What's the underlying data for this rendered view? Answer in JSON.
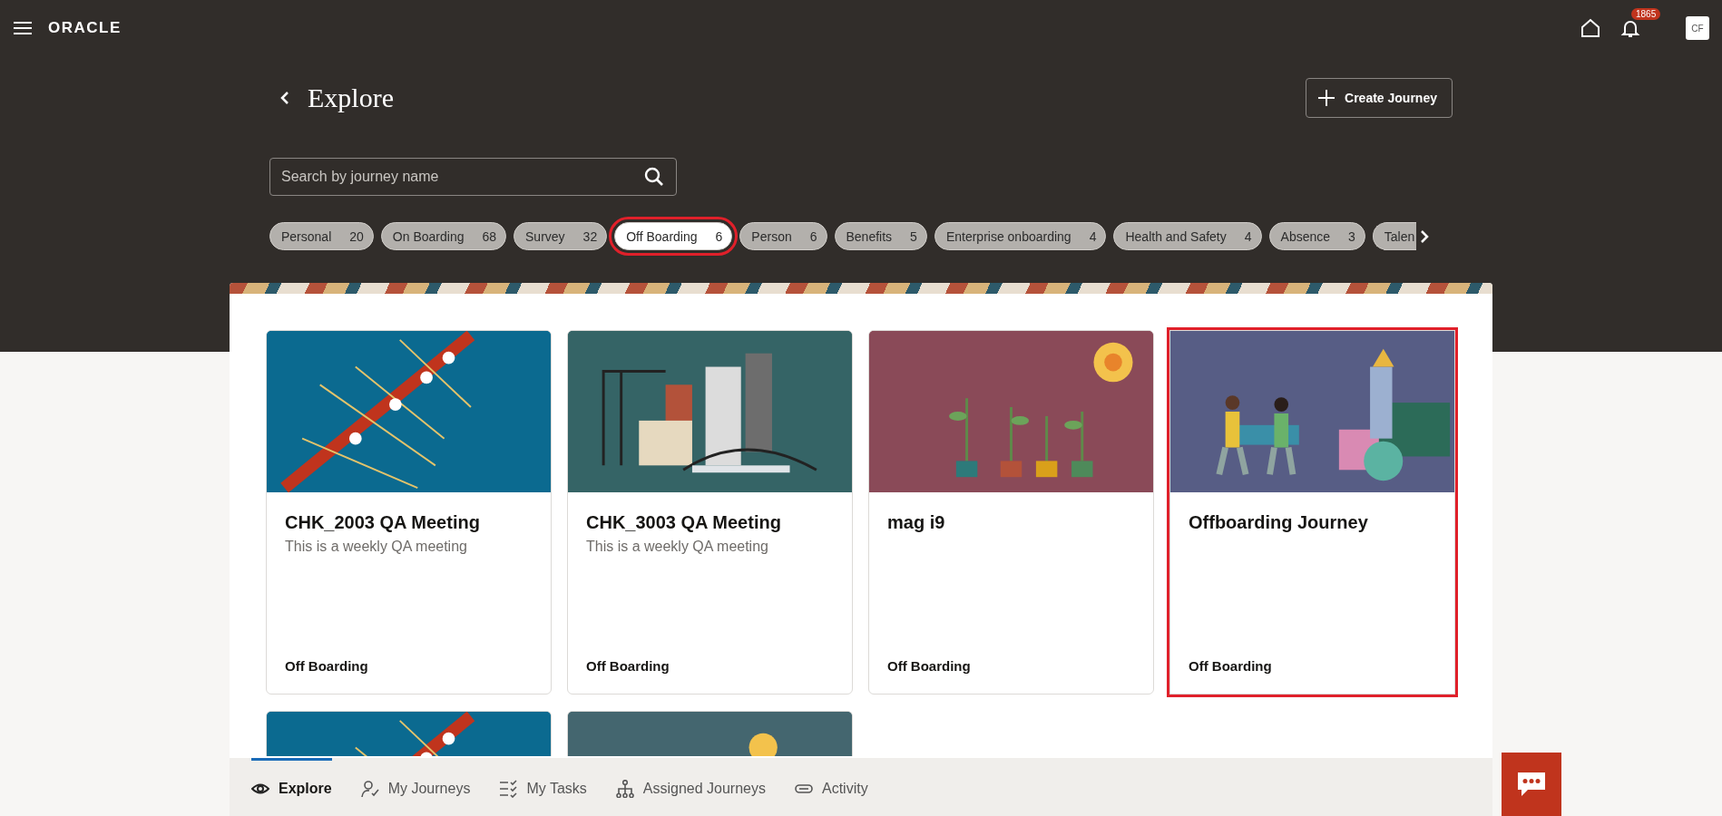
{
  "topbar": {
    "brand": "ORACLE",
    "notifications": "1865",
    "avatar": "CF"
  },
  "header": {
    "title": "Explore",
    "create_button": "Create Journey"
  },
  "search": {
    "placeholder": "Search by journey name"
  },
  "filters": [
    {
      "label": "Personal",
      "count": "20",
      "selected": false
    },
    {
      "label": "On Boarding",
      "count": "68",
      "selected": false
    },
    {
      "label": "Survey",
      "count": "32",
      "selected": false
    },
    {
      "label": "Off Boarding",
      "count": "6",
      "selected": true
    },
    {
      "label": "Person",
      "count": "6",
      "selected": false
    },
    {
      "label": "Benefits",
      "count": "5",
      "selected": false
    },
    {
      "label": "Enterprise onboarding",
      "count": "4",
      "selected": false
    },
    {
      "label": "Health and Safety",
      "count": "4",
      "selected": false
    },
    {
      "label": "Absence",
      "count": "3",
      "selected": false
    },
    {
      "label": "Talen",
      "selected": false
    }
  ],
  "cards": [
    {
      "kind": "rowing",
      "title": "CHK_2003 QA Meeting",
      "description": "This is a weekly QA meeting",
      "category": "Off Boarding",
      "highlighted": false
    },
    {
      "kind": "city",
      "title": "CHK_3003 QA Meeting",
      "description": "This is a weekly QA meeting",
      "category": "Off Boarding",
      "highlighted": false
    },
    {
      "kind": "plants",
      "title": "mag i9",
      "category": "Off Boarding",
      "highlighted": false
    },
    {
      "kind": "people",
      "title": "Offboarding Journey",
      "category": "Off Boarding",
      "highlighted": true
    },
    {
      "kind": "rowing"
    },
    {
      "kind": "sun"
    }
  ],
  "bottom_nav": [
    {
      "kind": "eye",
      "label": "Explore",
      "selected": true
    },
    {
      "kind": "person",
      "label": "My Journeys",
      "selected": false
    },
    {
      "kind": "tasks",
      "label": "My Tasks",
      "selected": false
    },
    {
      "kind": "tree",
      "label": "Assigned Journeys",
      "selected": false
    },
    {
      "kind": "pill",
      "label": "Activity",
      "selected": false
    }
  ]
}
